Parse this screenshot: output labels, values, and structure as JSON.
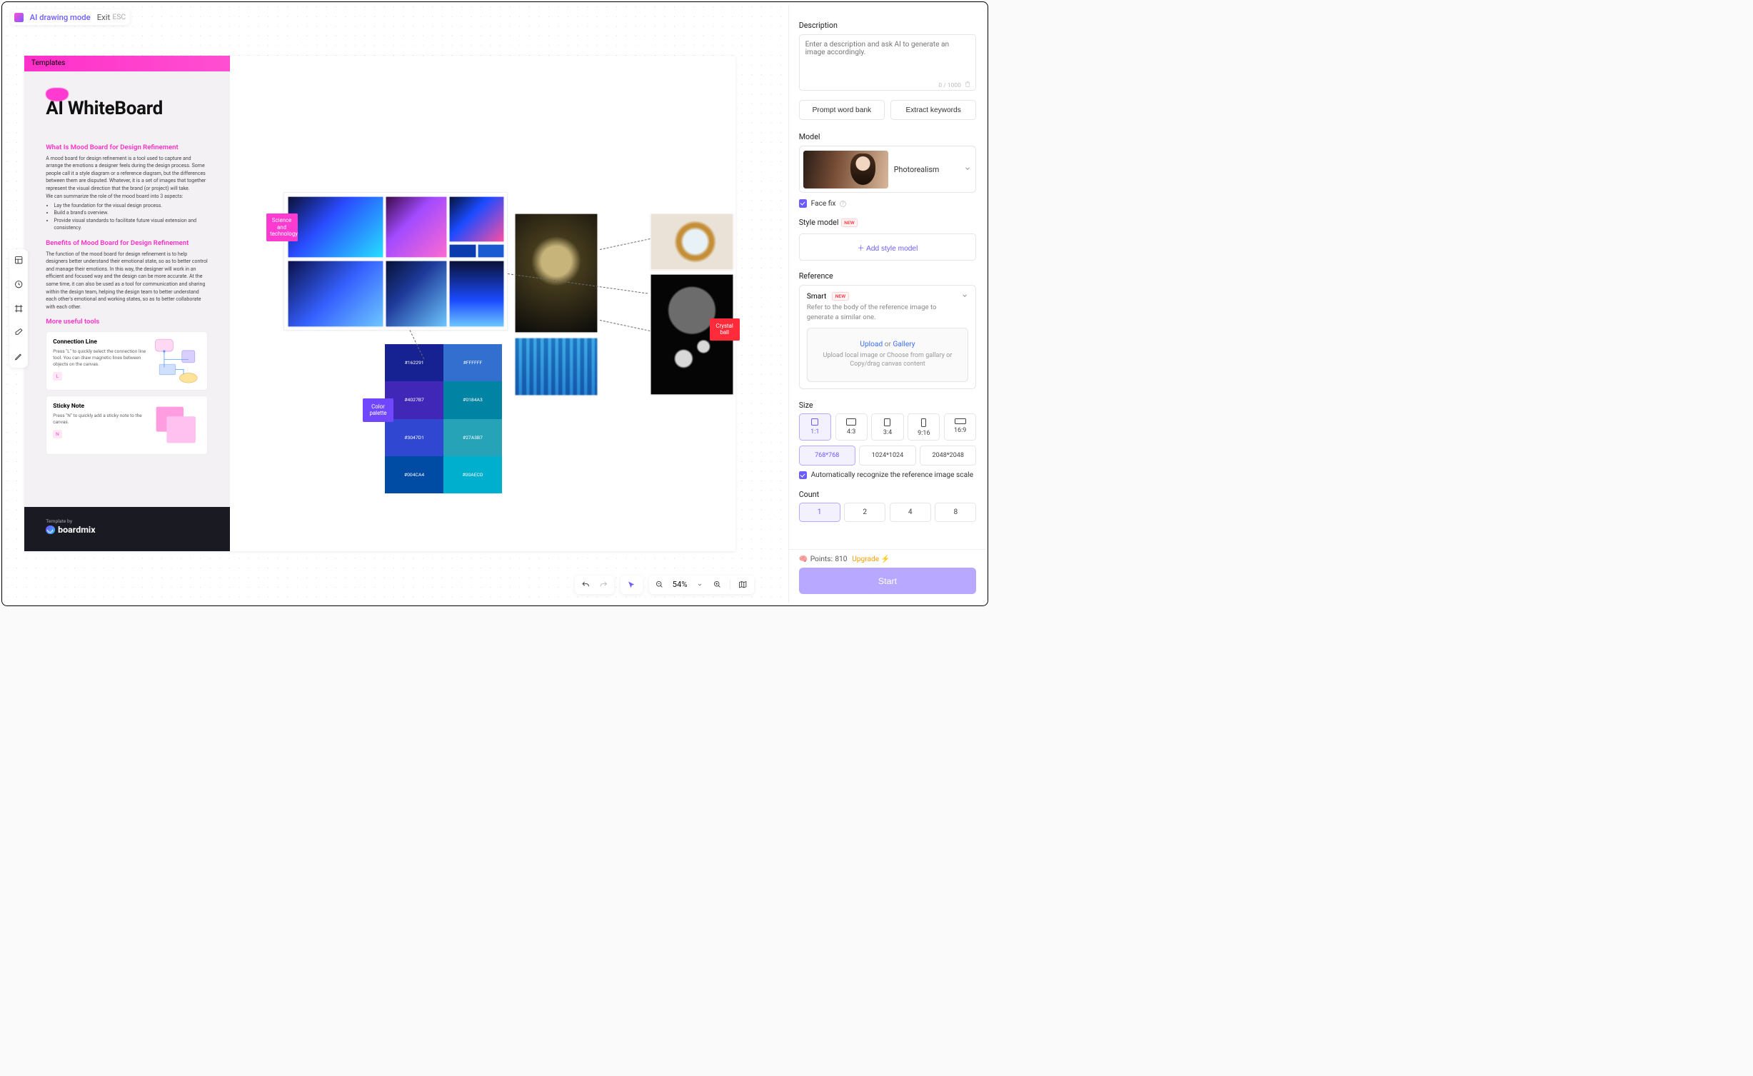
{
  "toolbar": {
    "ai_mode": "AI drawing mode",
    "exit": "Exit",
    "esc": "ESC"
  },
  "template": {
    "tab": "Templates",
    "title": "AI WhiteBoard",
    "sec1_title": "What Is Mood Board for Design Refinement",
    "sec1_para": "A mood board for design refinement is a tool used to capture and arrange the emotions a designer feels during the design process. Some people call it a style diagram or a reference diagram, but the differences between them are disputed. Whatever, it is a set of images that together represent the visual direction that the brand (or project) will take.",
    "sec1_lead": "We can summarize the role of the mood board into 3 aspects:",
    "sec1_b1": "Lay the foundation for the visual design process.",
    "sec1_b2": "Build a brand's overview.",
    "sec1_b3": "Provide visual standards to facilitate future visual extension and consistency.",
    "sec2_title": "Benefits of Mood Board for Design Refinement",
    "sec2_para": "The function of the mood board for design refinement is to help designers better understand their emotional state, so as to better control and manage their emotions. In this way, the designer will work in an efficient and focused way and the design can be more accurate. At the same time, it can also be used as a tool for communication and sharing within the design team, helping the design team to better understand each other's emotional and working states, so as to better collaborate with each other.",
    "sec3_title": "More useful tools",
    "card1_title": "Connection Line",
    "card1_body": "Press \"L\" to quickly select the connection line tool. You can draw magnetic lines between objects on the canvas.",
    "card1_key": "L",
    "card2_title": "Sticky Note",
    "card2_body": "Press \"N\" to quickly add a sticky note to the canvas.",
    "card2_key": "N",
    "footer_by": "Template by",
    "footer_brand": "boardmix"
  },
  "tags": {
    "science": "Science and technology",
    "palette": "Color palette",
    "crystal": "Crystal ball"
  },
  "palette": {
    "c0": "#162291",
    "c1": "#FFFFFF",
    "c2": "#4027B7",
    "c3": "#0184A3",
    "c4": "#3047D1",
    "c5": "#27A3B7",
    "c6": "#004CA4",
    "c7": "#00AECD"
  },
  "right": {
    "desc_title": "Description",
    "desc_placeholder": "Enter a description and ask AI to generate an image accordingly.",
    "char_counter": "0 / 1000",
    "prompt_bank": "Prompt word bank",
    "extract": "Extract keywords",
    "model_title": "Model",
    "model_name": "Photorealism",
    "face_fix": "Face fix",
    "style_title": "Style model",
    "add_style": "Add style model",
    "ref_title": "Reference",
    "smart": "Smart",
    "smart_desc": "Refer to the body of the reference image to generate a similar one.",
    "upload": "Upload",
    "or": "or",
    "gallery": "Gallery",
    "upload_sub": "Upload local image or Choose from gallary or Copy/drag canvas content",
    "size_title": "Size",
    "ratios": [
      "1:1",
      "4:3",
      "3:4",
      "9:16",
      "16:9"
    ],
    "resolutions": [
      "768*768",
      "1024*1024",
      "2048*2048"
    ],
    "auto_scale": "Automatically recognize the reference image scale",
    "count_title": "Count",
    "counts": [
      "1",
      "2",
      "4",
      "8"
    ],
    "points_label": "Points:",
    "points_value": "810",
    "upgrade": "Upgrade",
    "start": "Start",
    "new": "NEW"
  },
  "zoom": {
    "value": "54%"
  }
}
